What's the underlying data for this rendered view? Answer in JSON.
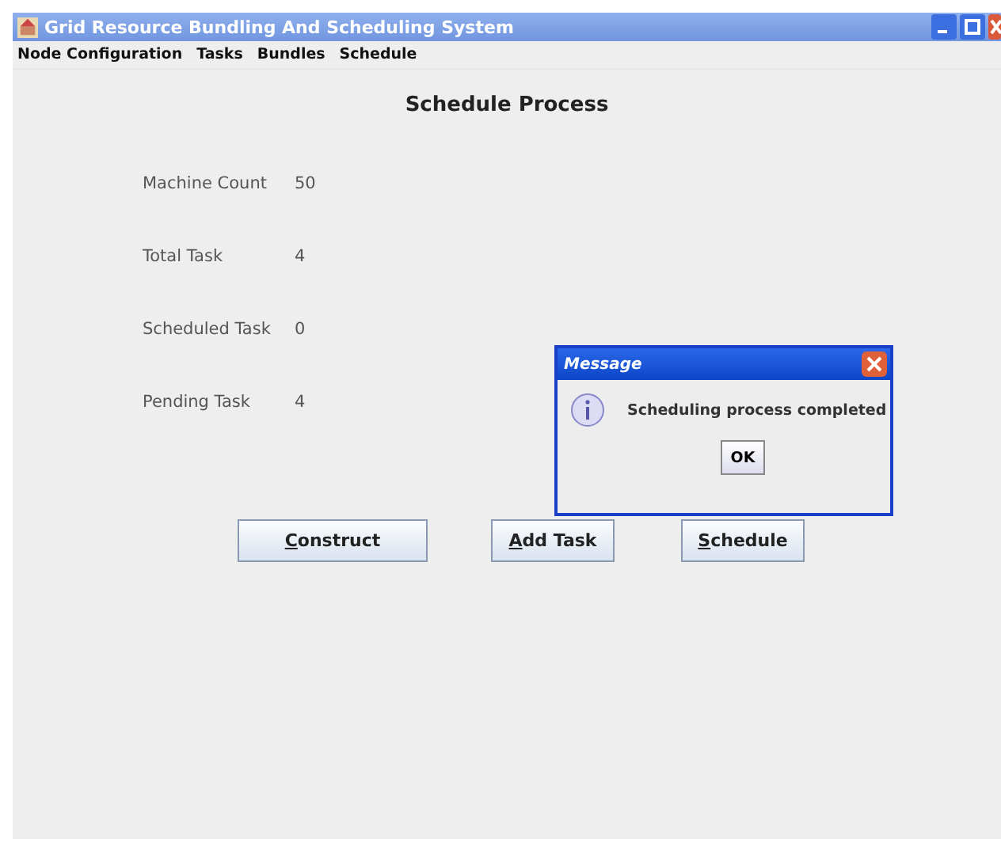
{
  "window": {
    "title": "Grid Resource Bundling And Scheduling System"
  },
  "menu": [
    "Node Configuration",
    "Tasks",
    "Bundles",
    "Schedule"
  ],
  "heading": "Schedule Process",
  "fields": [
    {
      "label": "Machine Count",
      "value": "50"
    },
    {
      "label": "Total Task",
      "value": "4"
    },
    {
      "label": "Scheduled Task",
      "value": "0"
    },
    {
      "label": "Pending Task",
      "value": "4"
    }
  ],
  "buttons": [
    "Construct",
    "Add Task",
    "Schedule"
  ],
  "dialog": {
    "title": "Message",
    "message": "Scheduling process completed",
    "button": "OK"
  }
}
